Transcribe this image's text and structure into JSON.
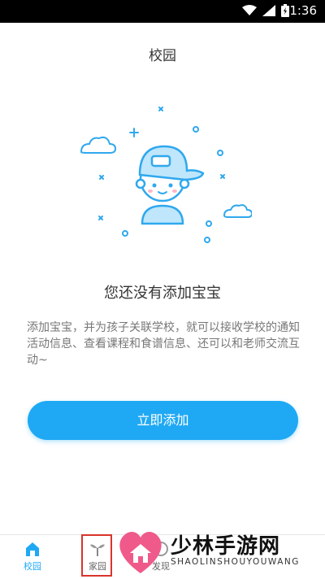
{
  "status_bar": {
    "time": "1:36",
    "icons": [
      "wifi-icon",
      "signal-icon",
      "battery-icon"
    ]
  },
  "header": {
    "title": "校园"
  },
  "empty_state": {
    "heading": "您还没有添加宝宝",
    "description": "添加宝宝，并为孩子关联学校，就可以接收学校的通知活动信息、查看课程和食谱信息、还可以和老师交流互动~",
    "button_label": "立即添加"
  },
  "tabs": [
    {
      "label": "校园",
      "icon": "school-icon",
      "active": true
    },
    {
      "label": "家园",
      "icon": "sprout-icon",
      "active": false
    },
    {
      "label": "发现",
      "icon": "discover-icon",
      "active": false
    }
  ],
  "watermark": {
    "cn": "少林手游网",
    "en": "SHAOLINSHOUYOUWANG"
  },
  "colors": {
    "accent": "#1fa9f4",
    "highlight": "#d9342b"
  }
}
